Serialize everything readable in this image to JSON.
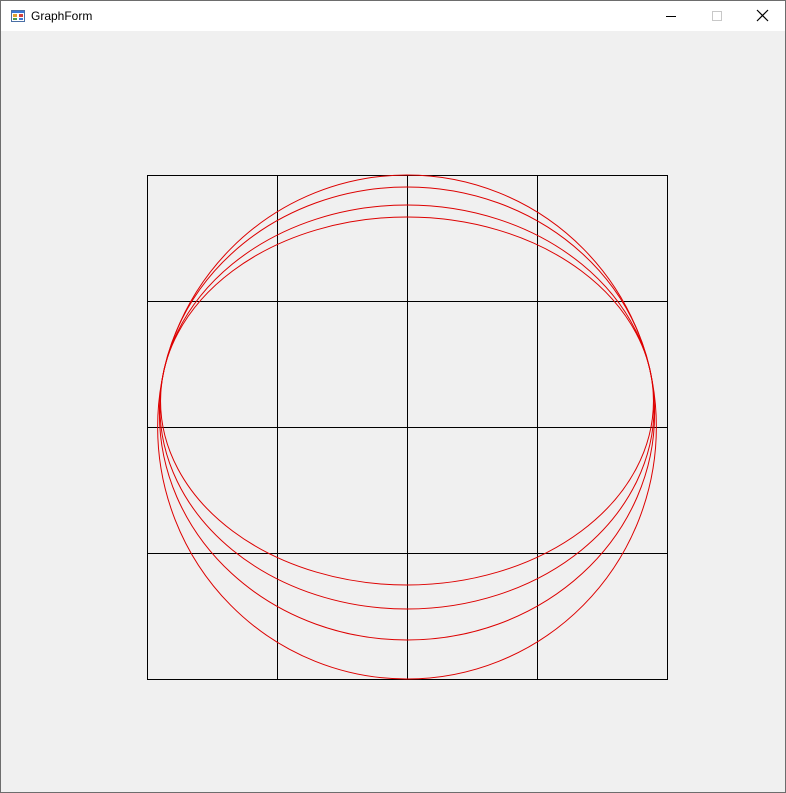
{
  "window": {
    "title": "GraphForm"
  },
  "icons": {
    "app": "form-app-icon",
    "minimize": "minimize-icon",
    "maximize": "maximize-icon",
    "close": "close-icon"
  },
  "graph": {
    "grid": {
      "cols": 4,
      "rows": 4,
      "color": "#000000"
    },
    "curve_color": "#dd0000",
    "background": "#f0f0f0"
  }
}
